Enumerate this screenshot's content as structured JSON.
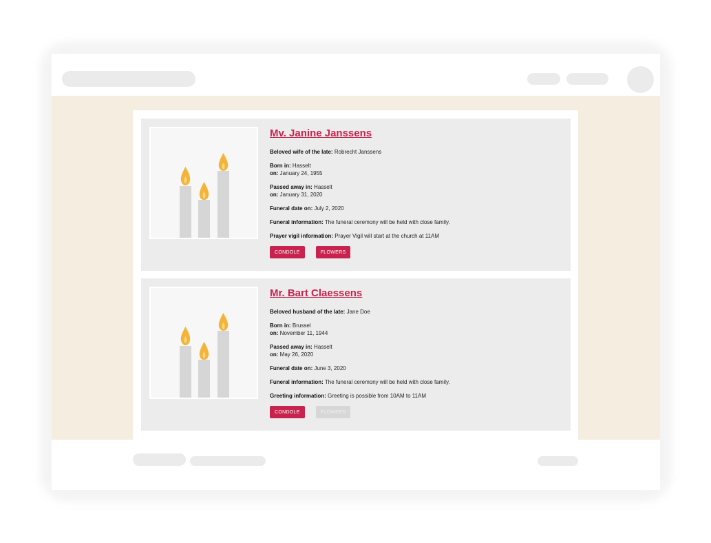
{
  "colors": {
    "accent": "#c8234f",
    "content_background": "#f4ede0",
    "card_background": "#ececec",
    "disabled_button": "#d7d7d7",
    "flame": "#f4b43a",
    "candle": "#d6d6d6"
  },
  "obituaries": [
    {
      "name": "Mv. Janine Janssens",
      "photo_icon": "candles-icon",
      "spouse_label": "Beloved wife of the late:",
      "spouse_value": "Robrecht Janssens",
      "born_in_label": "Born in:",
      "born_in_value": "Hasselt",
      "born_on_label": "on:",
      "born_on_value": "January 24, 1955",
      "passed_in_label": "Passed away in:",
      "passed_in_value": "Hasselt",
      "passed_on_label": "on:",
      "passed_on_value": "January 31, 2020",
      "funeral_date_label": "Funeral date on:",
      "funeral_date_value": "July 2, 2020",
      "funeral_info_label": "Funeral information:",
      "funeral_info_value": "The funeral ceremony will be held with close family.",
      "extra_label": "Prayer vigil information:",
      "extra_value": "Prayer Vigil will start at the church at 11AM",
      "condole_label": "CONDOLE",
      "flowers_label": "FLOWERS",
      "flowers_enabled": true
    },
    {
      "name": "Mr. Bart Claessens",
      "photo_icon": "candles-icon",
      "spouse_label": "Beloved husband of the late:",
      "spouse_value": "Jane Doe",
      "born_in_label": "Born in:",
      "born_in_value": "Brussel",
      "born_on_label": "on:",
      "born_on_value": "November 11, 1944",
      "passed_in_label": "Passed away in:",
      "passed_in_value": "Hasselt",
      "passed_on_label": "on:",
      "passed_on_value": "May 26, 2020",
      "funeral_date_label": "Funeral date on:",
      "funeral_date_value": "June 3, 2020",
      "funeral_info_label": "Funeral information:",
      "funeral_info_value": "The funeral ceremony will be held with close family.",
      "extra_label": "Greeting information:",
      "extra_value": "Greeting is possible from 10AM to 11AM",
      "condole_label": "CONDOLE",
      "flowers_label": "FLOWERS",
      "flowers_enabled": false
    }
  ]
}
